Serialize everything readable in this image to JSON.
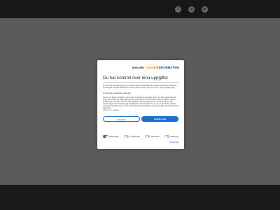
{
  "header": {
    "dots": "· · ·",
    "social": [
      {
        "name": "facebook-icon",
        "glyph": "f"
      },
      {
        "name": "instagram-icon",
        "glyph": "◎"
      },
      {
        "name": "youtube-icon",
        "glyph": "▶"
      }
    ]
  },
  "consent": {
    "logo": {
      "brand": "one.com",
      "plus": "+",
      "partner_a": "COOKIE",
      "partner_b": "INFORMATION"
    },
    "title": "Du har kontroll över dina uppgifter",
    "intro": "Vi och våra samarbetspartner använder tekniker baserade på cookies och liknande tekniker för att lagra och/eller få åtkomst till information på din enhet. Läs mer i vår integritetspolicy.",
    "purposes": "Funktionella, Statistiska, Marketing",
    "body": "Genom att klicka \"Godkänn\" ger du ditt samtycke till samtliga syften. Du kan också välja att ange vilka syften du samtycker till genom att bocka i rutan bredvid syftet och klicka \"Spara inställningar\". Du kan när som helst återkalla ditt samtycke genom att klicka på den lilla ikonen längst ned till vänster på webbplatsen. Du kan läsa mer om hur vi använder cookies och andra tekniker samt om vår insamling och behandling av personuppgifter genom att klicka på länken.",
    "link_text": "Läs mer om cookies",
    "buttons": {
      "reject": "Neka alla",
      "accept": "Godkänn alla"
    },
    "toggles": [
      {
        "label": "Nödvändiga",
        "on": true
      },
      {
        "label": "Funktionella",
        "on": false
      },
      {
        "label": "Statistiska",
        "on": false
      },
      {
        "label": "Marketing",
        "on": false
      }
    ],
    "details_link": "Visa detaljer",
    "colors": {
      "accent": "#1a6fcf",
      "partner": "#f07d00"
    }
  }
}
